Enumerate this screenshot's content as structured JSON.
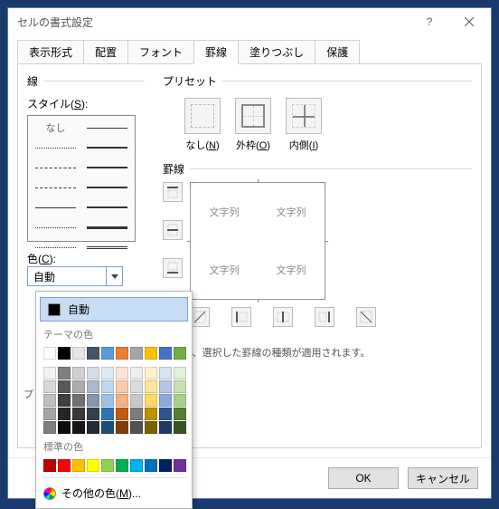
{
  "dialog": {
    "title": "セルの書式設定"
  },
  "tabs": [
    "表示形式",
    "配置",
    "フォント",
    "罫線",
    "塗りつぶし",
    "保護"
  ],
  "active_tab_index": 3,
  "line_group": "線",
  "style_label": "スタイル(S):",
  "style_none": "なし",
  "color_label": "色(C):",
  "color_value": "自動",
  "preset_group": "プリセット",
  "presets": [
    {
      "label": "なし(N)"
    },
    {
      "label": "外枠(O)"
    },
    {
      "label": "内側(I)"
    }
  ],
  "border_group": "罫線",
  "preview_cell": "文字列",
  "hint_text_partial": "すると、選択した罫線の種類が適用されます。",
  "hint_visible_prefix": "プ",
  "buttons": {
    "ok": "OK",
    "cancel": "キャンセル"
  },
  "color_picker": {
    "auto": "自動",
    "theme_label": "テーマの色",
    "standard_label": "標準の色",
    "more": "その他の色(M)...",
    "theme_colors_row1": [
      "#ffffff",
      "#000000",
      "#e7e6e6",
      "#44546a",
      "#5b9bd5",
      "#ed7d31",
      "#a5a5a5",
      "#ffc000",
      "#4472c4",
      "#70ad47"
    ],
    "theme_shades": [
      [
        "#f2f2f2",
        "#7f7f7f",
        "#d0cece",
        "#d6dce4",
        "#deebf6",
        "#fbe5d5",
        "#ededed",
        "#fff2cc",
        "#d9e2f3",
        "#e2efd9"
      ],
      [
        "#d8d8d8",
        "#595959",
        "#aeabab",
        "#adb9ca",
        "#bdd7ee",
        "#f7cbac",
        "#dbdbdb",
        "#fee599",
        "#b4c6e7",
        "#c5e0b3"
      ],
      [
        "#bfbfbf",
        "#3f3f3f",
        "#757070",
        "#8496b0",
        "#9cc3e5",
        "#f4b183",
        "#c9c9c9",
        "#ffd965",
        "#8eaadb",
        "#a8d08d"
      ],
      [
        "#a5a5a5",
        "#262626",
        "#3a3838",
        "#323f4f",
        "#2e75b5",
        "#c55a11",
        "#7b7b7b",
        "#bf9000",
        "#2f5496",
        "#538135"
      ],
      [
        "#7f7f7f",
        "#0c0c0c",
        "#171616",
        "#222a35",
        "#1e4e79",
        "#833c0b",
        "#525252",
        "#7f6000",
        "#1f3864",
        "#375623"
      ]
    ],
    "standard_colors": [
      "#c00000",
      "#ff0000",
      "#ffc000",
      "#ffff00",
      "#92d050",
      "#00b050",
      "#00b0f0",
      "#0070c0",
      "#002060",
      "#7030a0"
    ]
  }
}
